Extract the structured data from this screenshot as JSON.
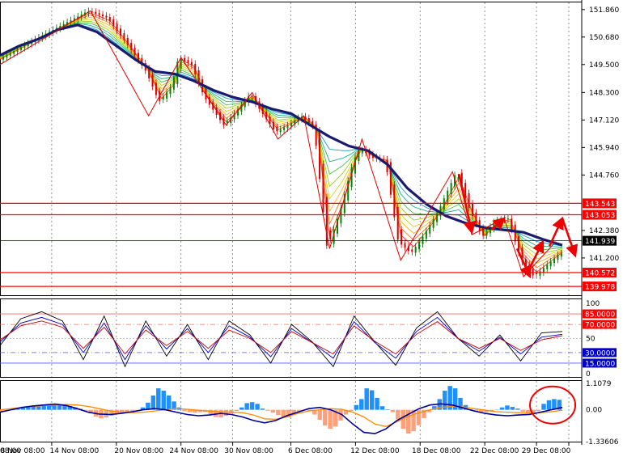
{
  "chart_data": [
    {
      "type": "line",
      "panel": "price",
      "indicators": [
        "moving-average-ribbon",
        "zigzag",
        "horizontal-levels"
      ],
      "price_scale_ticks": [
        "151.860",
        "150.680",
        "149.500",
        "148.300",
        "147.120",
        "145.940",
        "144.760",
        "142.380",
        "141.200"
      ],
      "ylim": [
        139.6,
        152.2
      ],
      "x_dates": [
        "8 Nov 08:00",
        "14 Nov 08:00",
        "20 Nov 08:00",
        "24 Nov 08:00",
        "30 Nov 08:00",
        "6 Dec 08:00",
        "12 Dec 08:00",
        "18 Dec 08:00",
        "22 Dec 08:00",
        "29 Dec 08:00"
      ],
      "x_partial_start": "08:00",
      "price_path": [
        [
          0,
          149.7
        ],
        [
          6,
          150.6
        ],
        [
          10,
          151.2
        ],
        [
          14,
          151.8
        ],
        [
          17,
          151.5
        ],
        [
          20,
          150.4
        ],
        [
          23,
          149.2
        ],
        [
          25,
          147.9
        ],
        [
          27,
          148.6
        ],
        [
          28,
          149.8
        ],
        [
          30,
          149.5
        ],
        [
          32,
          148.1
        ],
        [
          35,
          146.9
        ],
        [
          37,
          147.5
        ],
        [
          39,
          148.2
        ],
        [
          41,
          147.4
        ],
        [
          43,
          146.6
        ],
        [
          45,
          146.9
        ],
        [
          47,
          147.3
        ],
        [
          49,
          146.8
        ],
        [
          51,
          141.6
        ],
        [
          53,
          143.2
        ],
        [
          55,
          145.3
        ],
        [
          56,
          145.9
        ],
        [
          58,
          145.5
        ],
        [
          60,
          145.4
        ],
        [
          62,
          141.9
        ],
        [
          64,
          141.4
        ],
        [
          66,
          142.2
        ],
        [
          68,
          143.1
        ],
        [
          71,
          144.9
        ],
        [
          73,
          143.3
        ],
        [
          75,
          142.1
        ],
        [
          77,
          142.8
        ],
        [
          79,
          142.9
        ],
        [
          81,
          141.1
        ],
        [
          83,
          140.4
        ],
        [
          85,
          140.9
        ],
        [
          87,
          141.4
        ]
      ],
      "ma_thick": [
        [
          0,
          149.9
        ],
        [
          3,
          150.3
        ],
        [
          6,
          150.6
        ],
        [
          9,
          151.0
        ],
        [
          12,
          151.2
        ],
        [
          15,
          150.9
        ],
        [
          18,
          150.3
        ],
        [
          21,
          149.7
        ],
        [
          24,
          149.2
        ],
        [
          27,
          149.1
        ],
        [
          30,
          148.8
        ],
        [
          33,
          148.4
        ],
        [
          36,
          148.1
        ],
        [
          39,
          147.9
        ],
        [
          42,
          147.6
        ],
        [
          45,
          147.4
        ],
        [
          48,
          146.9
        ],
        [
          51,
          146.4
        ],
        [
          54,
          146.0
        ],
        [
          57,
          145.8
        ],
        [
          60,
          145.2
        ],
        [
          63,
          144.2
        ],
        [
          66,
          143.5
        ],
        [
          69,
          143.0
        ],
        [
          72,
          142.7
        ],
        [
          75,
          142.5
        ],
        [
          78,
          142.4
        ],
        [
          81,
          142.3
        ],
        [
          84,
          142.0
        ],
        [
          87,
          141.75
        ]
      ],
      "zigzag_points": [
        [
          0,
          149.5
        ],
        [
          14,
          151.8
        ],
        [
          23,
          147.3
        ],
        [
          28,
          149.8
        ],
        [
          35,
          146.9
        ],
        [
          39,
          148.3
        ],
        [
          43,
          146.3
        ],
        [
          47,
          147.3
        ],
        [
          51,
          141.6
        ],
        [
          56,
          146.3
        ],
        [
          62,
          141.1
        ],
        [
          70,
          144.9
        ],
        [
          73,
          142.2
        ],
        [
          78,
          142.9
        ],
        [
          81,
          140.4
        ],
        [
          86,
          141.9
        ]
      ],
      "horizontal_levels": [
        {
          "value": 143.543,
          "label": "143.543",
          "color": "#ff0000"
        },
        {
          "value": 143.053,
          "label": "143.053",
          "color": "#ff0000"
        },
        {
          "value": 141.939,
          "label": "141.939",
          "color": "#000080"
        },
        {
          "value": 140.572,
          "label": "140.572",
          "color": "#ff0000"
        },
        {
          "value": 139.978,
          "label": "139.978",
          "color": "#ff0000"
        }
      ],
      "annotation_arrows": [
        {
          "from": [
            71,
            144.8
          ],
          "to": [
            73,
            142.3
          ]
        },
        {
          "from": [
            76,
            142.4
          ],
          "to": [
            78,
            142.9
          ]
        },
        {
          "from": [
            80,
            141.6
          ],
          "to": [
            82,
            140.4
          ]
        },
        {
          "from": [
            82,
            140.8
          ],
          "to": [
            84,
            141.9
          ]
        },
        {
          "from": [
            85,
            141.7
          ],
          "to": [
            87,
            142.9
          ]
        },
        {
          "from": [
            87,
            142.9
          ],
          "to": [
            89,
            141.3
          ]
        }
      ]
    },
    {
      "type": "line",
      "panel": "oscillator",
      "scale_ticks": [
        "100",
        "50",
        "0"
      ],
      "levels": [
        {
          "value": 85,
          "label": "85.0000"
        },
        {
          "value": 70,
          "label": "70.0000"
        },
        {
          "value": 30,
          "label": "30.0000"
        },
        {
          "value": 15,
          "label": "15.0000"
        }
      ],
      "ylim": [
        0,
        100
      ],
      "series": [
        {
          "color": "#000000",
          "values": [
            40,
            78,
            88,
            75,
            20,
            82,
            10,
            75,
            25,
            70,
            20,
            75,
            55,
            15,
            70,
            45,
            10,
            82,
            45,
            12,
            65,
            88,
            50,
            25,
            55,
            18,
            58,
            60
          ]
        },
        {
          "color": "#0000cc",
          "values": [
            45,
            72,
            80,
            70,
            30,
            72,
            20,
            68,
            35,
            64,
            30,
            68,
            52,
            24,
            64,
            44,
            22,
            74,
            44,
            22,
            60,
            80,
            50,
            32,
            52,
            28,
            52,
            56
          ]
        },
        {
          "color": "#cc0000",
          "values": [
            48,
            68,
            75,
            66,
            36,
            66,
            28,
            62,
            40,
            60,
            36,
            62,
            50,
            30,
            60,
            44,
            28,
            68,
            46,
            28,
            56,
            74,
            50,
            36,
            50,
            33,
            48,
            54
          ]
        }
      ]
    },
    {
      "type": "bar",
      "panel": "macd",
      "scale_ticks": [
        "1.1079",
        "0.00",
        "-1.33606"
      ],
      "ylim": [
        -1.33606,
        1.1079
      ],
      "histogram": [
        -0.08,
        -0.05,
        0.0,
        0.05,
        0.1,
        0.14,
        0.18,
        0.2,
        0.22,
        0.24,
        0.24,
        0.22,
        0.2,
        0.16,
        0.1,
        0.04,
        -0.05,
        -0.15,
        -0.28,
        -0.36,
        -0.32,
        -0.25,
        -0.18,
        -0.12,
        -0.08,
        -0.05,
        -0.02,
        0.1,
        0.3,
        0.6,
        0.9,
        0.8,
        0.6,
        0.35,
        0.1,
        -0.06,
        -0.1,
        -0.12,
        -0.1,
        -0.08,
        -0.18,
        -0.3,
        -0.32,
        -0.25,
        -0.15,
        -0.05,
        0.1,
        0.28,
        0.32,
        0.25,
        0.05,
        -0.04,
        -0.12,
        -0.22,
        -0.3,
        -0.32,
        -0.2,
        -0.08,
        -0.02,
        -0.06,
        -0.2,
        -0.42,
        -0.66,
        -0.8,
        -0.7,
        -0.45,
        -0.2,
        -0.05,
        0.2,
        0.45,
        0.9,
        0.82,
        0.5,
        0.15,
        0.02,
        -0.1,
        -0.4,
        -0.8,
        -1.0,
        -0.9,
        -0.65,
        -0.35,
        -0.1,
        0.15,
        0.45,
        0.8,
        1.0,
        0.9,
        0.5,
        0.2,
        0.02,
        -0.08,
        -0.12,
        -0.1,
        -0.06,
        0.0,
        0.1,
        0.18,
        0.12,
        0.05,
        -0.08,
        -0.16,
        -0.12,
        -0.05,
        0.25,
        0.4,
        0.45,
        0.42
      ],
      "signal_orange": [
        0.0,
        0.05,
        0.1,
        0.14,
        0.18,
        0.2,
        0.22,
        0.2,
        0.14,
        0.05,
        -0.05,
        -0.1,
        -0.12,
        -0.1,
        -0.05,
        0.0,
        0.05,
        0.02,
        -0.02,
        -0.06,
        -0.08,
        -0.1,
        -0.12,
        -0.22,
        -0.38,
        -0.4,
        -0.3,
        -0.15,
        -0.05,
        0.0,
        0.05,
        0.02,
        -0.1,
        -0.3,
        -0.6,
        -0.7,
        -0.5,
        -0.28,
        -0.12,
        0.0,
        0.1,
        0.14,
        0.12,
        0.05,
        -0.02,
        -0.08,
        -0.1,
        -0.12,
        -0.15,
        -0.12,
        -0.08,
        -0.02
      ],
      "macd_navy": [
        -0.1,
        0.0,
        0.1,
        0.16,
        0.2,
        0.24,
        0.18,
        0.05,
        -0.1,
        -0.18,
        -0.2,
        -0.15,
        -0.08,
        0.0,
        0.05,
        0.0,
        -0.1,
        -0.2,
        -0.25,
        -0.22,
        -0.15,
        -0.2,
        -0.3,
        -0.45,
        -0.55,
        -0.45,
        -0.25,
        -0.1,
        0.05,
        0.1,
        0.0,
        -0.2,
        -0.6,
        -0.95,
        -1.0,
        -0.8,
        -0.45,
        -0.2,
        0.05,
        0.2,
        0.25,
        0.2,
        0.08,
        -0.05,
        -0.15,
        -0.22,
        -0.25,
        -0.22,
        -0.2,
        -0.1,
        0.0,
        0.1
      ]
    }
  ],
  "colors": {
    "background": "#ffffff",
    "grid": "#808080",
    "thick_ma": "#1a1a6e",
    "zigzag": "#e00000",
    "level_red": "#ff0000",
    "level_navy": "#000080",
    "hist_up": "#1e90ff",
    "hist_down": "#ffa07a",
    "signal": "#ff8c00",
    "annotation": "#ee0000"
  }
}
